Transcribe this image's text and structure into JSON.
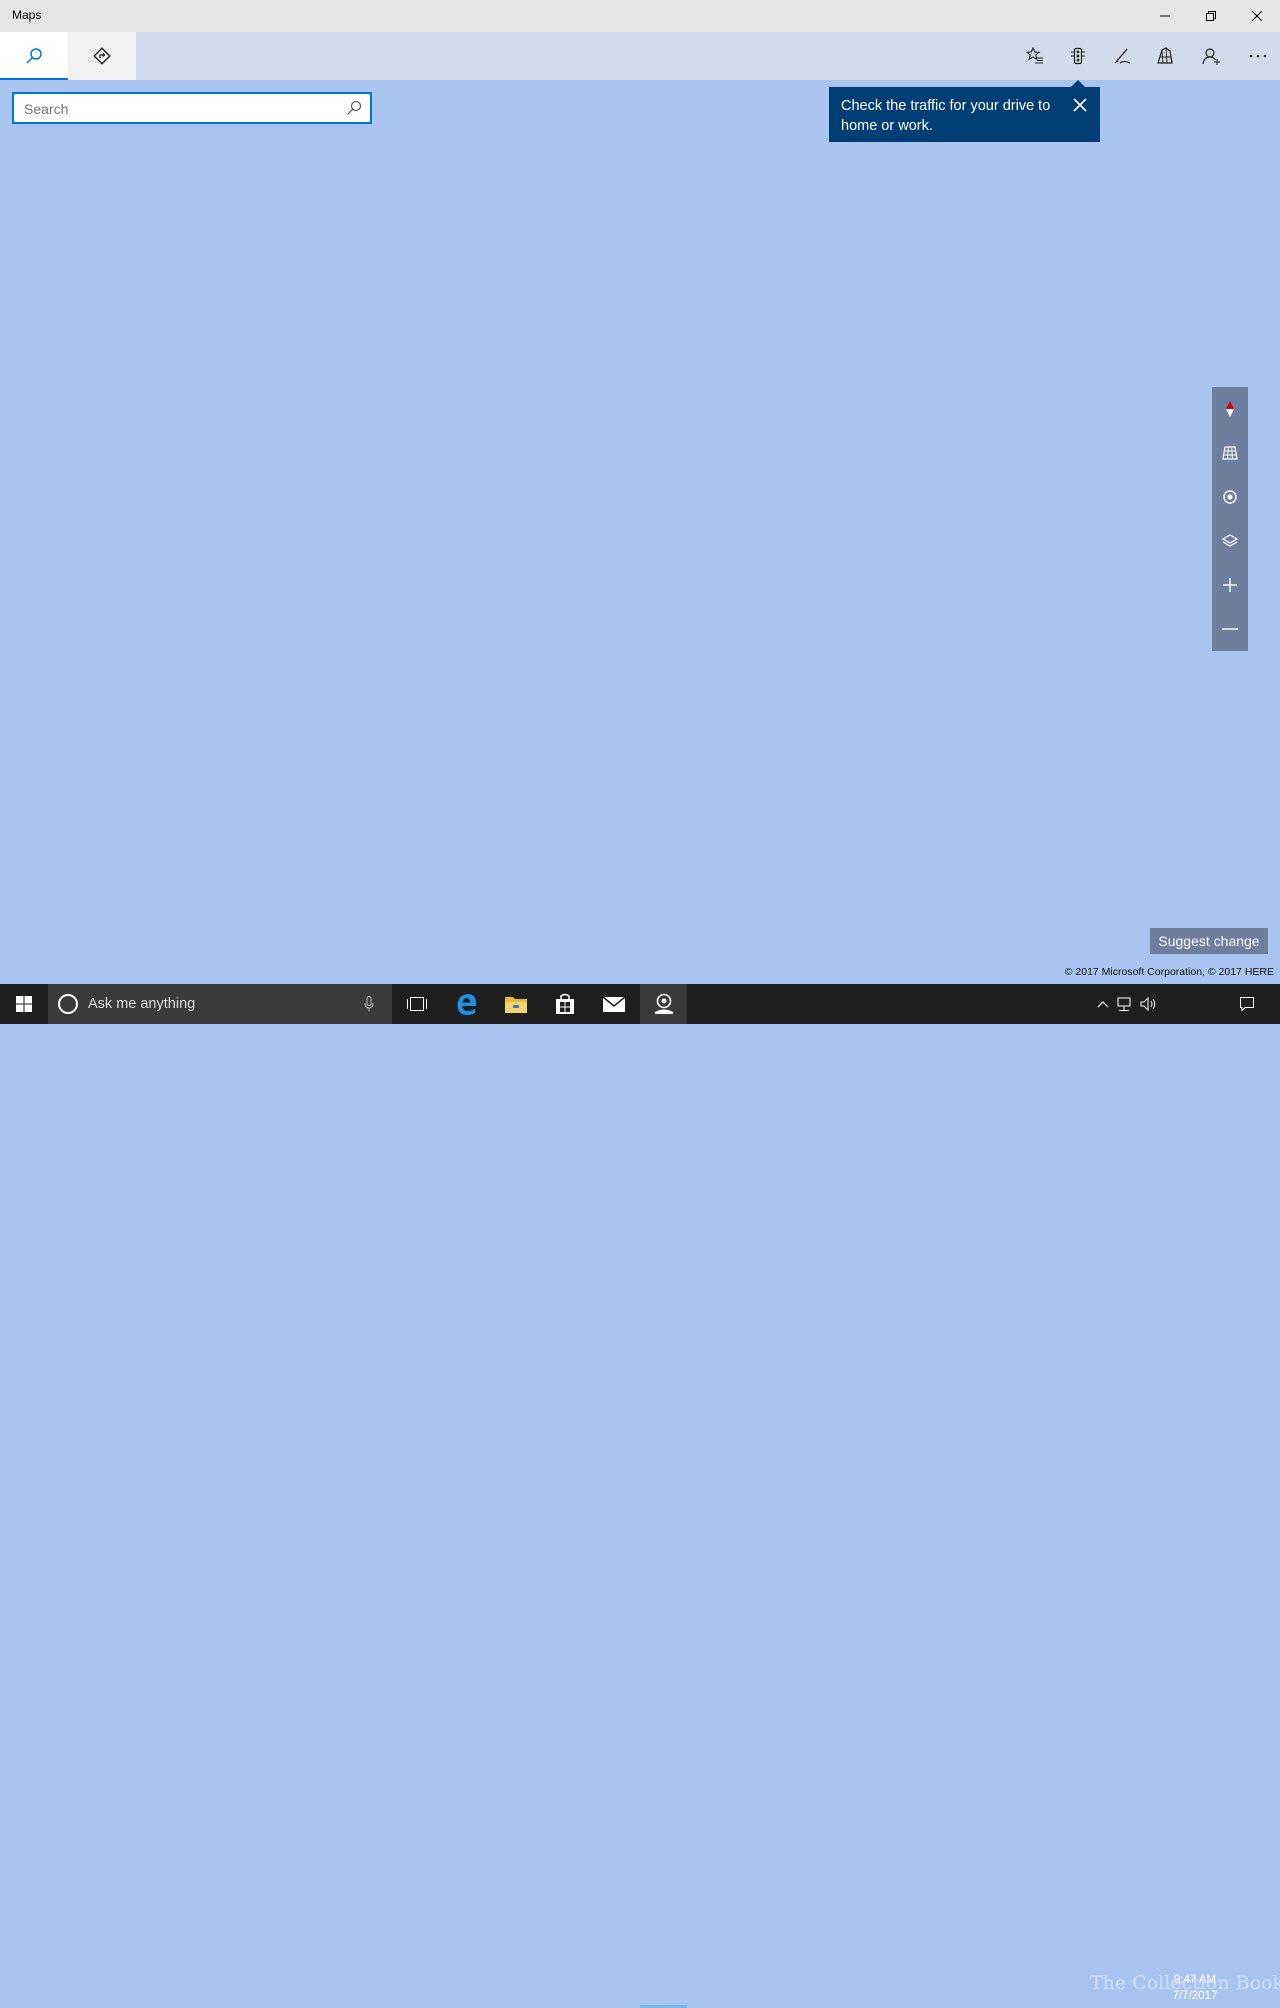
{
  "window": {
    "title": "Maps"
  },
  "tabs": [
    {
      "name": "search",
      "icon": "search-icon",
      "active": true
    },
    {
      "name": "directions",
      "icon": "directions-icon",
      "active": false
    }
  ],
  "commands": [
    {
      "icon": "favorites-icon"
    },
    {
      "icon": "traffic-icon"
    },
    {
      "icon": "ink-pen-icon"
    },
    {
      "icon": "3d-cities-icon"
    },
    {
      "icon": "account-icon"
    },
    {
      "icon": "more-icon"
    }
  ],
  "search": {
    "placeholder": "Search",
    "value": ""
  },
  "tooltip": {
    "message": "Check the traffic for your drive to home or work."
  },
  "map": {
    "background_color": "#aac4f0",
    "controls": [
      "compass-icon",
      "tilt-icon",
      "my-location-icon",
      "map-layers-icon",
      "zoom-in-icon",
      "zoom-out-icon"
    ],
    "suggest_label": "Suggest change",
    "copyright": "© 2017 Microsoft Corporation, © 2017 HERE"
  },
  "taskbar": {
    "cortana_placeholder": "Ask me anything",
    "time": "9:47 AM",
    "date": "7/7/2017",
    "watermark": "The Collection Book"
  },
  "colors": {
    "accent": "#0078d7",
    "tooltip_bg": "#003e73",
    "control_bg": "#6d7f9c"
  }
}
